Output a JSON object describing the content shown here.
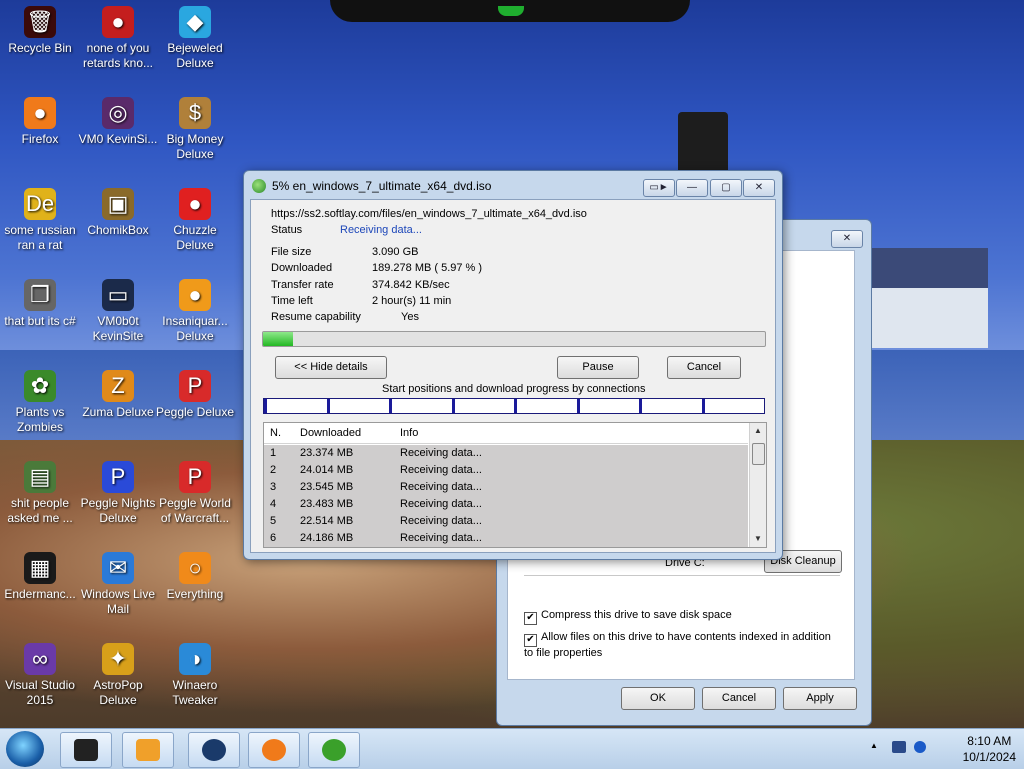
{
  "desktop": {
    "icons": [
      {
        "label": "Recycle Bin",
        "icon": "recycle-bin-icon",
        "glyph": "🗑",
        "color": "#3b0a0a"
      },
      {
        "label": "none of you retards kno...",
        "icon": "sonic-icon",
        "glyph": "●",
        "color": "#c41e1e"
      },
      {
        "label": "Bejeweled Deluxe",
        "icon": "gem-icon",
        "glyph": "◆",
        "color": "#2aa7e0"
      },
      {
        "label": "Firefox",
        "icon": "firefox-icon",
        "glyph": "●",
        "color": "#f07a1a"
      },
      {
        "label": "VM0 KevinSi...",
        "icon": "firefox-dark-icon",
        "glyph": "◎",
        "color": "#5a2a6a"
      },
      {
        "label": "Big Money Deluxe",
        "icon": "money-bag-icon",
        "glyph": "$",
        "color": "#b0803a"
      },
      {
        "label": "some russian ran a rat",
        "icon": "de-icon",
        "glyph": "De",
        "color": "#e0b21a"
      },
      {
        "label": "ChomikBox",
        "icon": "chomikbox-icon",
        "glyph": "▣",
        "color": "#8a6a2a"
      },
      {
        "label": "Chuzzle Deluxe",
        "icon": "chuzzle-icon",
        "glyph": "●",
        "color": "#e02020"
      },
      {
        "label": "that but its c#",
        "icon": "windows-copy-icon",
        "glyph": "❐",
        "color": "#666666"
      },
      {
        "label": "VM0b0t KevinSite",
        "icon": "monitor-icon",
        "glyph": "▭",
        "color": "#1b2a4a"
      },
      {
        "label": "Insaniquar... Deluxe",
        "icon": "fish-icon",
        "glyph": "●",
        "color": "#f09a1a"
      },
      {
        "label": "Plants vs Zombies",
        "icon": "plant-icon",
        "glyph": "✿",
        "color": "#3a8a2a"
      },
      {
        "label": "Zuma Deluxe",
        "icon": "zuma-icon",
        "glyph": "Z",
        "color": "#e08a1a"
      },
      {
        "label": "Peggle Deluxe",
        "icon": "peggle-icon",
        "glyph": "P",
        "color": "#d82a2a"
      },
      {
        "label": "shit people asked me ...",
        "icon": "file-icon",
        "glyph": "▤",
        "color": "#4a7a3a"
      },
      {
        "label": "Peggle Nights Deluxe",
        "icon": "peggle-nights-icon",
        "glyph": "P",
        "color": "#2a4ad8"
      },
      {
        "label": "Peggle World of Warcraft...",
        "icon": "peggle-wow-icon",
        "glyph": "P",
        "color": "#d82a2a"
      },
      {
        "label": "Endermanc...",
        "icon": "console-icon",
        "glyph": "▦",
        "color": "#1a1a1a"
      },
      {
        "label": "Windows Live Mail",
        "icon": "mail-icon",
        "glyph": "✉",
        "color": "#2a7ad8"
      },
      {
        "label": "Everything",
        "icon": "magnifier-icon",
        "glyph": "○",
        "color": "#f08a1a"
      },
      {
        "label": "Visual Studio 2015",
        "icon": "visual-studio-icon",
        "glyph": "∞",
        "color": "#6a3aa8"
      },
      {
        "label": "AstroPop Deluxe",
        "icon": "astropop-icon",
        "glyph": "✦",
        "color": "#d8a01a"
      },
      {
        "label": "Winaero Tweaker",
        "icon": "winaero-icon",
        "glyph": "◑",
        "color": "#2a8ad8"
      }
    ]
  },
  "idm": {
    "title": "5% en_windows_7_ultimate_x64_dvd.iso",
    "url": "https://ss2.softlay.com/files/en_windows_7_ultimate_x64_dvd.iso",
    "status_label": "Status",
    "status_value": "Receiving data...",
    "fields": [
      {
        "label": "File size",
        "value": "3.090  GB"
      },
      {
        "label": "Downloaded",
        "value": "189.278  MB  ( 5.97 % )"
      },
      {
        "label": "Transfer rate",
        "value": "374.842  KB/sec"
      },
      {
        "label": "Time left",
        "value": "2 hour(s) 11 min"
      },
      {
        "label": "Resume capability",
        "value": "Yes"
      }
    ],
    "progress_percent": 5.97,
    "hide_details_label": "<< Hide details",
    "pause_label": "Pause",
    "cancel_label": "Cancel",
    "connections_caption": "Start positions and download progress by connections",
    "connection_count": 8,
    "table_headers": {
      "n": "N.",
      "downloaded": "Downloaded",
      "info": "Info"
    },
    "connections": [
      {
        "n": "1",
        "downloaded": "23.374  MB",
        "info": "Receiving data..."
      },
      {
        "n": "2",
        "downloaded": "24.014  MB",
        "info": "Receiving data..."
      },
      {
        "n": "3",
        "downloaded": "23.545  MB",
        "info": "Receiving data..."
      },
      {
        "n": "4",
        "downloaded": "23.483  MB",
        "info": "Receiving data..."
      },
      {
        "n": "5",
        "downloaded": "22.514  MB",
        "info": "Receiving data..."
      },
      {
        "n": "6",
        "downloaded": "24.186  MB",
        "info": "Receiving data..."
      }
    ],
    "buttons": {
      "minimize": "—",
      "maximize": "▢",
      "close": "✕",
      "extra": "▭►"
    }
  },
  "drive_props": {
    "close_label": "✕",
    "drive_label": "Drive C:",
    "disk_cleanup_label": "Disk Cleanup",
    "compress_label": "Compress this drive to save disk space",
    "index_label": "Allow files on this drive to have contents indexed in addition to file properties",
    "ok_label": "OK",
    "cancel_label": "Cancel",
    "apply_label": "Apply"
  },
  "taskbar": {
    "time": "8:10 AM",
    "date": "10/1/2024",
    "tray_arrow": "▲"
  }
}
